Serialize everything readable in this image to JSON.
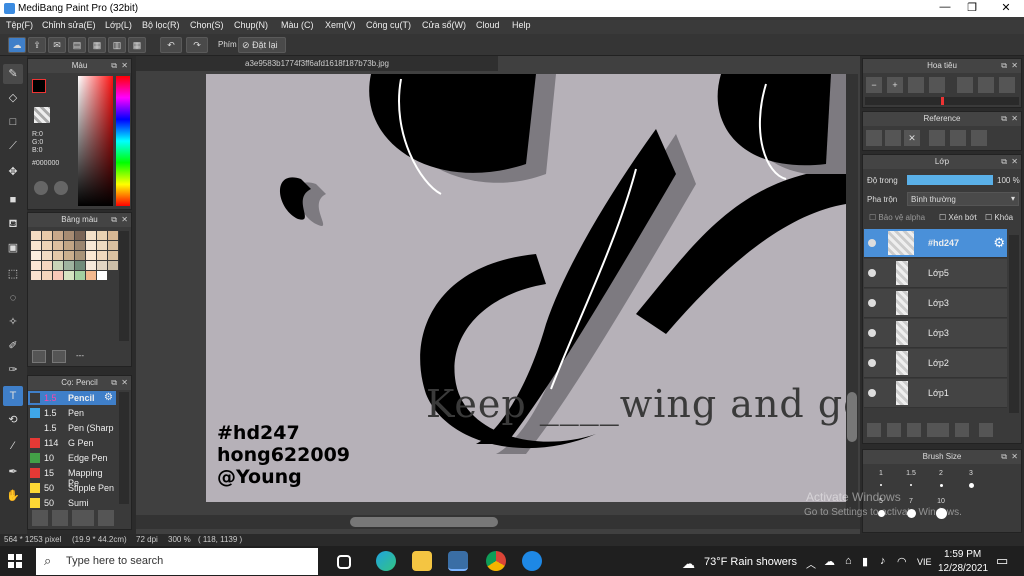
{
  "app": {
    "title": "MediBang Paint Pro (32bit)"
  },
  "menu": [
    "Tệp(F)",
    "Chỉnh sửa(E)",
    "Lớp(L)",
    "Bộ lọc(R)",
    "Chọn(S)",
    "Chụp(N)",
    "Màu (C)",
    "Xem(V)",
    "Công cụ(T)",
    "Cửa sổ(W)",
    "Cloud",
    "Help"
  ],
  "toolbar": {
    "phim_label": "Phím",
    "reset_label": "Đặt lại"
  },
  "color_panel": {
    "title": "Màu",
    "r": "R:0",
    "g": "G:0",
    "b": "B:0",
    "hex": "#000000"
  },
  "palette_panel": {
    "title": "Bảng màu",
    "footer": "---"
  },
  "brush_panel": {
    "title": "Cọ: Pencil",
    "items": [
      {
        "size": "1.5",
        "name": "Pencil",
        "color": "#3a3a3a"
      },
      {
        "size": "1.5",
        "name": "Pen",
        "color": "#3fa7e8"
      },
      {
        "size": "1.5",
        "name": "Pen (Sharp",
        "color": "#3a3a3a"
      },
      {
        "size": "114",
        "name": "G Pen",
        "color": "#e53935"
      },
      {
        "size": "10",
        "name": "Edge Pen",
        "color": "#43a047"
      },
      {
        "size": "15",
        "name": "Mapping Pe",
        "color": "#e53935"
      },
      {
        "size": "50",
        "name": "Stipple Pen",
        "color": "#fdd835"
      },
      {
        "size": "50",
        "name": "Sumi",
        "color": "#fdd835"
      }
    ]
  },
  "canvas": {
    "filename": "a3e9583b1774f3ff6afd1618f187b73b.jpg",
    "watermark_line1": "#hd247",
    "watermark_line2": "hong622009",
    "watermark_line3": "@Young",
    "quote": "Keep ____wing and go"
  },
  "navigator": {
    "title": "Hoa tiêu"
  },
  "reference": {
    "title": "Reference"
  },
  "layers": {
    "title": "Lớp",
    "opacity_label": "Độ trong",
    "opacity_value": "100 %",
    "blend_label": "Pha trộn",
    "blend_value": "Bình thường",
    "protect_alpha": "Bảo vệ alpha",
    "clipping": "Xén bớt",
    "lock": "Khóa",
    "items": [
      {
        "name": "#hd247",
        "selected": true
      },
      {
        "name": "Lớp5",
        "selected": false
      },
      {
        "name": "Lớp3",
        "selected": false
      },
      {
        "name": "Lớp3",
        "selected": false
      },
      {
        "name": "Lớp2",
        "selected": false
      },
      {
        "name": "Lớp1",
        "selected": false
      }
    ]
  },
  "brush_size": {
    "title": "Brush Size",
    "sizes": [
      "1",
      "1.5",
      "2",
      "3",
      "5",
      "7",
      "10"
    ]
  },
  "status": {
    "dims": "564 * 1253 pixel",
    "cm": "(19.9 * 44.2cm)",
    "dpi": "72 dpi",
    "zoom": "300 %",
    "coords": "( 118, 1139 )"
  },
  "activate": {
    "line1": "Activate Windows",
    "line2": "Go to Settings to activate Windows."
  },
  "taskbar": {
    "search_placeholder": "Type here to search",
    "weather": "73°F  Rain showers",
    "lang": "VIE",
    "time": "1:59 PM",
    "date": "12/28/2021"
  }
}
